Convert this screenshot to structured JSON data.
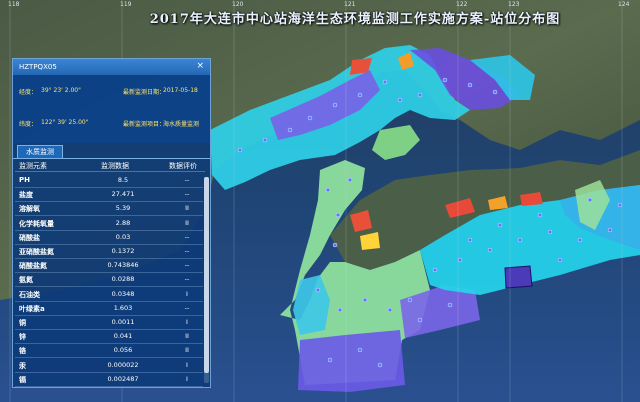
{
  "title": "2017年大连市中心站海洋生态环境监测工作实施方案-站位分布图",
  "grid_coords": [
    "118",
    "119",
    "120",
    "121",
    "122",
    "123",
    "124"
  ],
  "popup": {
    "station_code": "HZTPQX05",
    "close_icon": "×",
    "longitude_label": "经度：",
    "longitude_value": "39° 23' 2.00\"",
    "last_date_label": "最新监测日期：",
    "last_date_value": "2017-05-18",
    "latitude_label": "纬度：",
    "latitude_value": "122° 39' 25.00\"",
    "last_project_label": "最新监测项目：",
    "last_project_value": "海水质量监测",
    "tab_label": "水质监测",
    "columns": [
      "监测元素",
      "监测数据",
      "数据评价"
    ],
    "rows": [
      {
        "element": "PH",
        "value": "8.5",
        "evaluation": "--"
      },
      {
        "element": "盐度",
        "value": "27.471",
        "evaluation": "--"
      },
      {
        "element": "溶解氧",
        "value": "5.39",
        "evaluation": "II"
      },
      {
        "element": "化学耗氧量",
        "value": "2.88",
        "evaluation": "II"
      },
      {
        "element": "硝酸盐",
        "value": "0.03",
        "evaluation": "--"
      },
      {
        "element": "亚硝酸盐氮",
        "value": "0.1372",
        "evaluation": "--"
      },
      {
        "element": "硝酸盐氮",
        "value": "0.743846",
        "evaluation": "--"
      },
      {
        "element": "氨氮",
        "value": "0.0288",
        "evaluation": "--"
      },
      {
        "element": "石油类",
        "value": "0.0348",
        "evaluation": "I"
      },
      {
        "element": "叶绿素a",
        "value": "1.603",
        "evaluation": "--"
      },
      {
        "element": "铜",
        "value": "0.0011",
        "evaluation": "I"
      },
      {
        "element": "锌",
        "value": "0.041",
        "evaluation": "II"
      },
      {
        "element": "铬",
        "value": "0.056",
        "evaluation": "II"
      },
      {
        "element": "汞",
        "value": "0.000022",
        "evaluation": "I"
      },
      {
        "element": "镉",
        "value": "0.002487",
        "evaluation": "I"
      }
    ]
  }
}
